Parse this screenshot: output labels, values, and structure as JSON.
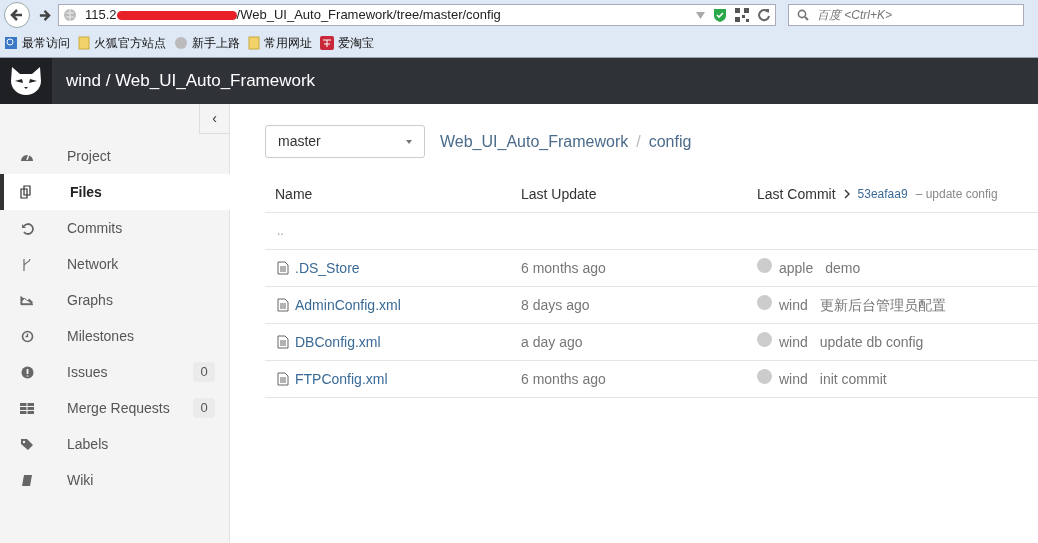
{
  "browser": {
    "url_start": "115.2",
    "url_redacted": true,
    "url_end": "/Web_UI_Auto_Framework/tree/master/config",
    "search_placeholder": "百度 <Ctrl+K>"
  },
  "bookmarks": [
    "最常访问",
    "火狐官方站点",
    "新手上路",
    "常用网址",
    "爱淘宝"
  ],
  "header": {
    "title": "wind / Web_UI_Auto_Framework"
  },
  "sidebar": {
    "collapse": "‹",
    "items": [
      {
        "label": "Project",
        "selected": false
      },
      {
        "label": "Files",
        "selected": true
      },
      {
        "label": "Commits",
        "selected": false
      },
      {
        "label": "Network",
        "selected": false
      },
      {
        "label": "Graphs",
        "selected": false
      },
      {
        "label": "Milestones",
        "selected": false
      },
      {
        "label": "Issues",
        "selected": false,
        "count": "0"
      },
      {
        "label": "Merge Requests",
        "selected": false,
        "count": "0"
      },
      {
        "label": "Labels",
        "selected": false
      },
      {
        "label": "Wiki",
        "selected": false
      }
    ]
  },
  "branch": "master",
  "breadcrumb": [
    "Web_UI_Auto_Framework",
    "config"
  ],
  "breadcrumb_separator": "/",
  "table": {
    "columns": [
      "Name",
      "Last Update",
      "Last Commit"
    ],
    "last_commit": {
      "hash": "53eafaa9",
      "message": "– update config"
    },
    "parent": "..",
    "rows": [
      {
        "name": ".DS_Store",
        "updated": "6 months ago",
        "author": "apple",
        "message": "demo"
      },
      {
        "name": "AdminConfig.xml",
        "updated": "8 days ago",
        "author": "wind",
        "message": "更新后台管理员配置"
      },
      {
        "name": "DBConfig.xml",
        "updated": "a day ago",
        "author": "wind",
        "message": "update db config"
      },
      {
        "name": "FTPConfig.xml",
        "updated": "6 months ago",
        "author": "wind",
        "message": "init commit"
      }
    ]
  }
}
